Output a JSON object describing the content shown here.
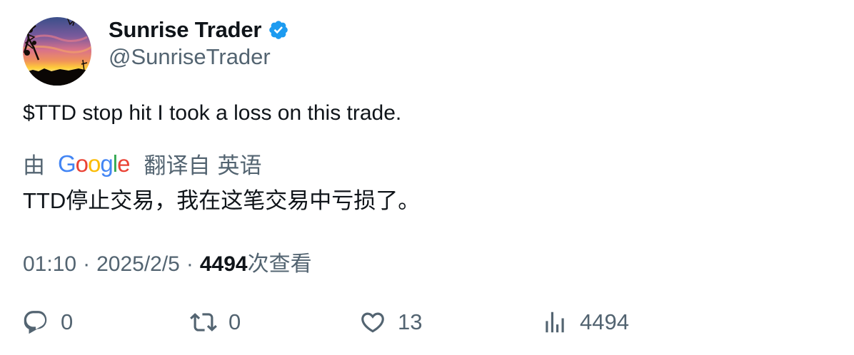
{
  "user": {
    "display_name": "Sunrise Trader",
    "handle": "@SunriseTrader",
    "verified": true,
    "avatar": "sunset-landscape-avatar"
  },
  "tweet": {
    "text": "$TTD stop hit I took a loss on this trade."
  },
  "translation": {
    "by_label": "由",
    "provider_letters": [
      "G",
      "o",
      "o",
      "g",
      "l",
      "e"
    ],
    "from_label": "翻译自",
    "language": "英语",
    "text": "TTD停止交易，我在这笔交易中亏损了。"
  },
  "meta": {
    "time": "01:10",
    "separator": "·",
    "date": "2025/2/5",
    "views_count": "4494",
    "views_label": "次查看"
  },
  "actions": {
    "reply_count": "0",
    "retweet_count": "0",
    "like_count": "13",
    "views_count": "4494"
  },
  "colors": {
    "text_primary": "#0f1419",
    "text_secondary": "#536471",
    "verified_blue": "#1d9bf0",
    "google_blue": "#4285F4",
    "google_red": "#EA4335",
    "google_yellow": "#FBBC05",
    "google_green": "#34A853"
  },
  "icons": {
    "reply": "reply-icon",
    "retweet": "retweet-icon",
    "like": "heart-icon",
    "views": "bar-chart-icon",
    "verified": "verified-badge-icon"
  }
}
